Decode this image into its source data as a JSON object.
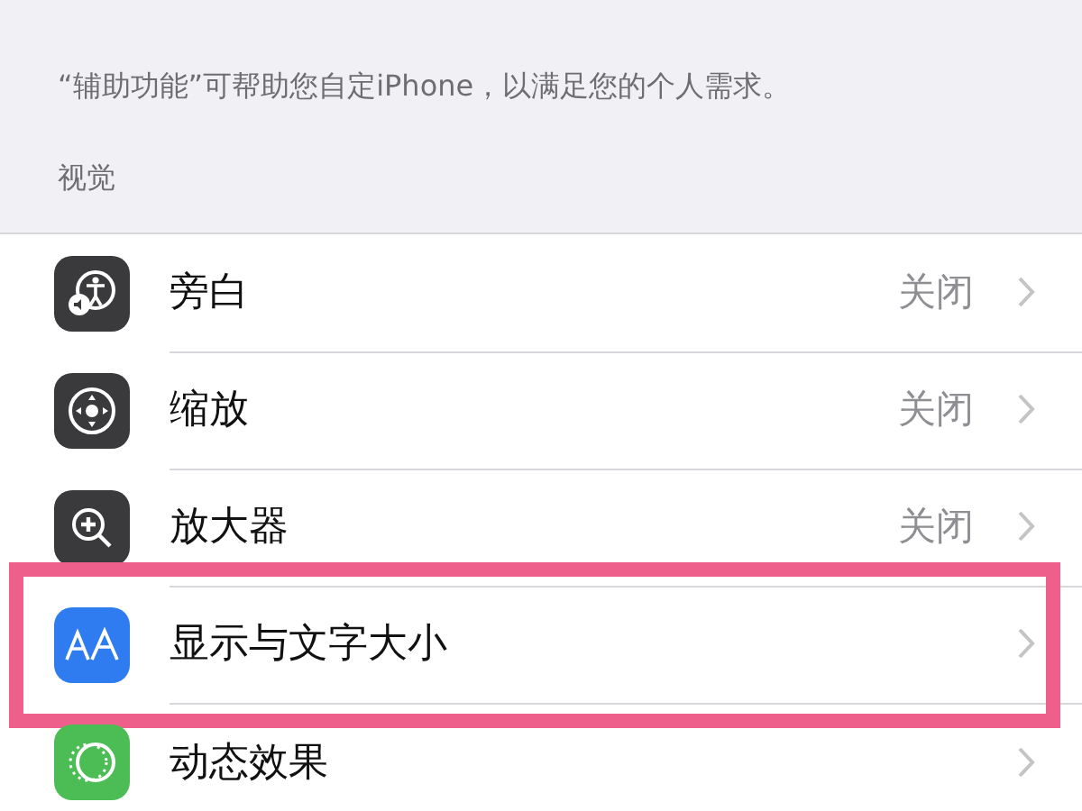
{
  "description": "“辅助功能”可帮助您自定iPhone，以满足您的个人需求。",
  "section_header": "视觉",
  "rows": [
    {
      "kind": "accessibility",
      "label": "旁白",
      "value": "关闭",
      "highlighted": false
    },
    {
      "kind": "zoom",
      "label": "缩放",
      "value": "关闭",
      "highlighted": false
    },
    {
      "kind": "magnifier",
      "label": "放大器",
      "value": "关闭",
      "highlighted": false
    },
    {
      "kind": "text-size",
      "label": "显示与文字大小",
      "highlighted": true
    },
    {
      "kind": "motion",
      "label": "动态效果",
      "highlighted": false
    }
  ]
}
